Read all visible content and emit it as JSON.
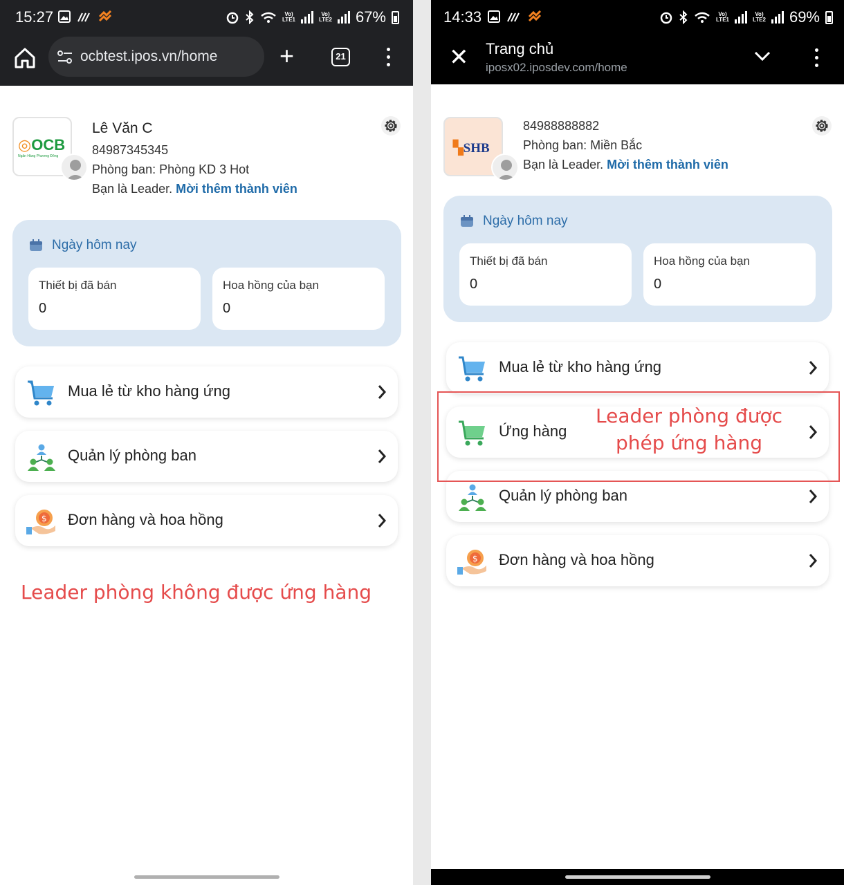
{
  "left": {
    "status": {
      "time": "15:27",
      "battery": "67%"
    },
    "browser": {
      "url": "ocbtest.ipos.vn/home",
      "tab_count": "21"
    },
    "profile": {
      "logo": "OCB",
      "name": "Lê Văn C",
      "phone": "84987345345",
      "department": "Phòng ban: Phòng KD 3 Hot",
      "leader_text": "Bạn là Leader. ",
      "invite_link": "Mời thêm thành viên"
    },
    "today": {
      "title": "Ngày hôm nay",
      "devices_label": "Thiết bị đã bán",
      "devices_value": "0",
      "commission_label": "Hoa hồng của bạn",
      "commission_value": "0"
    },
    "menu": [
      {
        "label": "Mua lẻ từ kho hàng ứng",
        "icon": "cart-blue-icon"
      },
      {
        "label": "Quản lý phòng ban",
        "icon": "team-icon"
      },
      {
        "label": "Đơn hàng và hoa hồng",
        "icon": "commission-icon"
      }
    ],
    "annotation": "Leader phòng không được ứng hàng"
  },
  "right": {
    "status": {
      "time": "14:33",
      "battery": "69%"
    },
    "header": {
      "title": "Trang chủ",
      "url": "iposx02.iposdev.com/home"
    },
    "profile": {
      "logo": "SHB",
      "phone": "84988888882",
      "department": "Phòng ban: Miền Bắc",
      "leader_text": "Bạn là Leader. ",
      "invite_link": "Mời thêm thành viên"
    },
    "today": {
      "title": "Ngày hôm nay",
      "devices_label": "Thiết bị đã bán",
      "devices_value": "0",
      "commission_label": "Hoa hồng của bạn",
      "commission_value": "0"
    },
    "menu": [
      {
        "label": "Mua lẻ từ kho hàng ứng",
        "icon": "cart-blue-icon"
      },
      {
        "label": "Ứng hàng",
        "icon": "cart-green-icon"
      },
      {
        "label": "Quản lý phòng ban",
        "icon": "team-icon"
      },
      {
        "label": "Đơn hàng và hoa hồng",
        "icon": "commission-icon"
      }
    ],
    "annotation_line1": "Leader phòng được",
    "annotation_line2": "phép ứng hàng"
  },
  "colors": {
    "accent_link": "#1e6aa8",
    "annotation": "#e54b4b",
    "today_bg": "#dbe7f3"
  }
}
